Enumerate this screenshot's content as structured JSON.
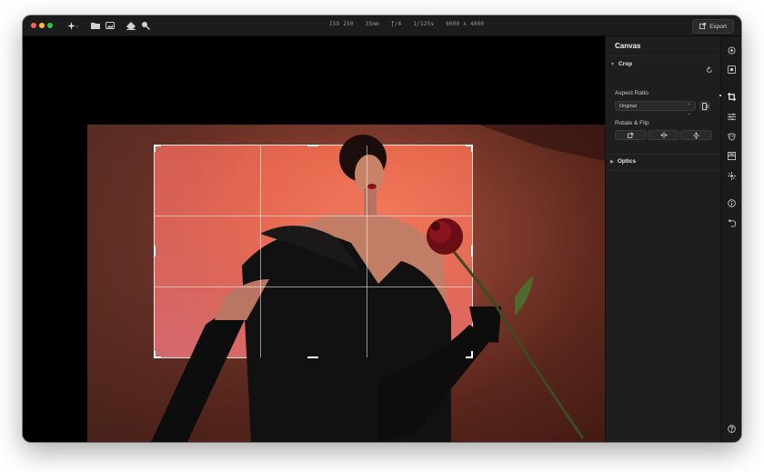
{
  "toolbar": {
    "export_label": "Export",
    "icons": [
      "sparkle-icon",
      "folder-icon",
      "image-icon",
      "eraser-icon",
      "zoom-icon"
    ]
  },
  "exif": {
    "iso": "ISO 250",
    "focal_length": "35mm",
    "aperture": "ƒ/4",
    "shutter": "1/125s",
    "dimensions": "6000 x 4000"
  },
  "panel": {
    "title": "Canvas",
    "crop": {
      "title": "Crop",
      "aspect_ratio_label": "Aspect Ratio",
      "aspect_ratio_value": "Original",
      "rotate_flip_label": "Rotate & Flip"
    },
    "optics": {
      "title": "Optics"
    }
  },
  "colors": {
    "window_bg": "#1b1b1c",
    "panel_bg": "#1e1e1f",
    "traffic_red": "#fe5f57",
    "traffic_yellow": "#febc2e",
    "traffic_green": "#28c840"
  }
}
